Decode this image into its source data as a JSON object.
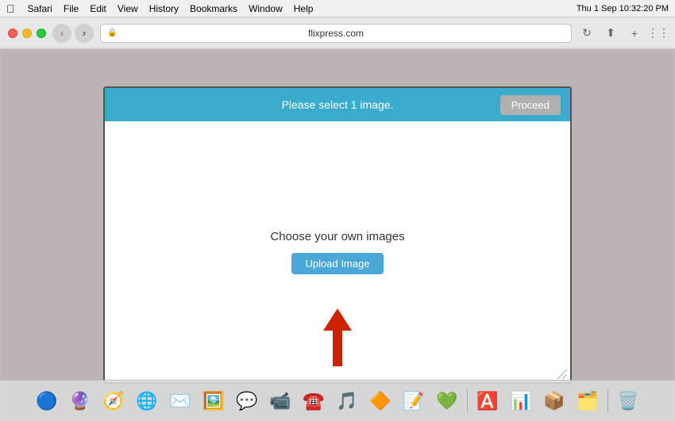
{
  "menubar": {
    "apple_symbol": "",
    "items": [
      "Safari",
      "File",
      "Edit",
      "View",
      "History",
      "Bookmarks",
      "Window",
      "Help"
    ],
    "time": "Thu 1 Sep  10:32:20 PM"
  },
  "browser": {
    "address": "flixpress.com",
    "back_label": "‹",
    "forward_label": "›",
    "refresh_label": "↻"
  },
  "modal": {
    "header_bg": "#3aabcc",
    "title": "Please select 1 image.",
    "proceed_label": "Proceed",
    "choose_text": "Choose your own images",
    "upload_label": "Upload Image"
  },
  "dock": {
    "icons": [
      {
        "name": "finder",
        "emoji": "🔵",
        "label": "Finder"
      },
      {
        "name": "siri",
        "emoji": "🔮",
        "label": "Siri"
      },
      {
        "name": "safari",
        "emoji": "🧭",
        "label": "Safari"
      },
      {
        "name": "chrome",
        "emoji": "🌐",
        "label": "Chrome"
      },
      {
        "name": "mail",
        "emoji": "✉️",
        "label": "Mail"
      },
      {
        "name": "photos",
        "emoji": "🖼️",
        "label": "Photos"
      },
      {
        "name": "messages",
        "emoji": "💬",
        "label": "Messages"
      },
      {
        "name": "facetime",
        "emoji": "📹",
        "label": "FaceTime"
      },
      {
        "name": "skype",
        "emoji": "☎️",
        "label": "Skype"
      },
      {
        "name": "spotify",
        "emoji": "🎵",
        "label": "Spotify"
      },
      {
        "name": "vlc",
        "emoji": "🔶",
        "label": "VLC"
      },
      {
        "name": "word",
        "emoji": "📝",
        "label": "Word"
      },
      {
        "name": "wechat",
        "emoji": "💚",
        "label": "WeChat"
      },
      {
        "name": "appstore",
        "emoji": "🅰️",
        "label": "App Store"
      },
      {
        "name": "excel",
        "emoji": "📊",
        "label": "Excel"
      },
      {
        "name": "unknown1",
        "emoji": "📦",
        "label": "App"
      },
      {
        "name": "unknown2",
        "emoji": "🗂️",
        "label": "App"
      },
      {
        "name": "trash",
        "emoji": "🗑️",
        "label": "Trash"
      }
    ]
  }
}
